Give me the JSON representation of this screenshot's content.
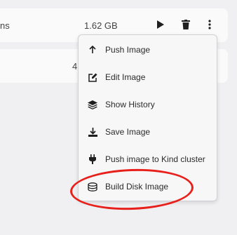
{
  "images": [
    {
      "name": "ns",
      "size": "1.62 GB"
    },
    {
      "name": "",
      "size": "4"
    }
  ],
  "menu": {
    "items": [
      {
        "label": "Push Image",
        "icon": "arrow-up-icon"
      },
      {
        "label": "Edit Image",
        "icon": "edit-icon"
      },
      {
        "label": "Show History",
        "icon": "layers-icon"
      },
      {
        "label": "Save Image",
        "icon": "download-icon"
      },
      {
        "label": "Push image to Kind cluster",
        "icon": "plug-icon"
      },
      {
        "label": "Build Disk Image",
        "icon": "disk-icon"
      }
    ]
  },
  "colors": {
    "highlight": "#e8201b",
    "background": "#f0f0f2",
    "menu_bg": "#f7f7f8"
  }
}
